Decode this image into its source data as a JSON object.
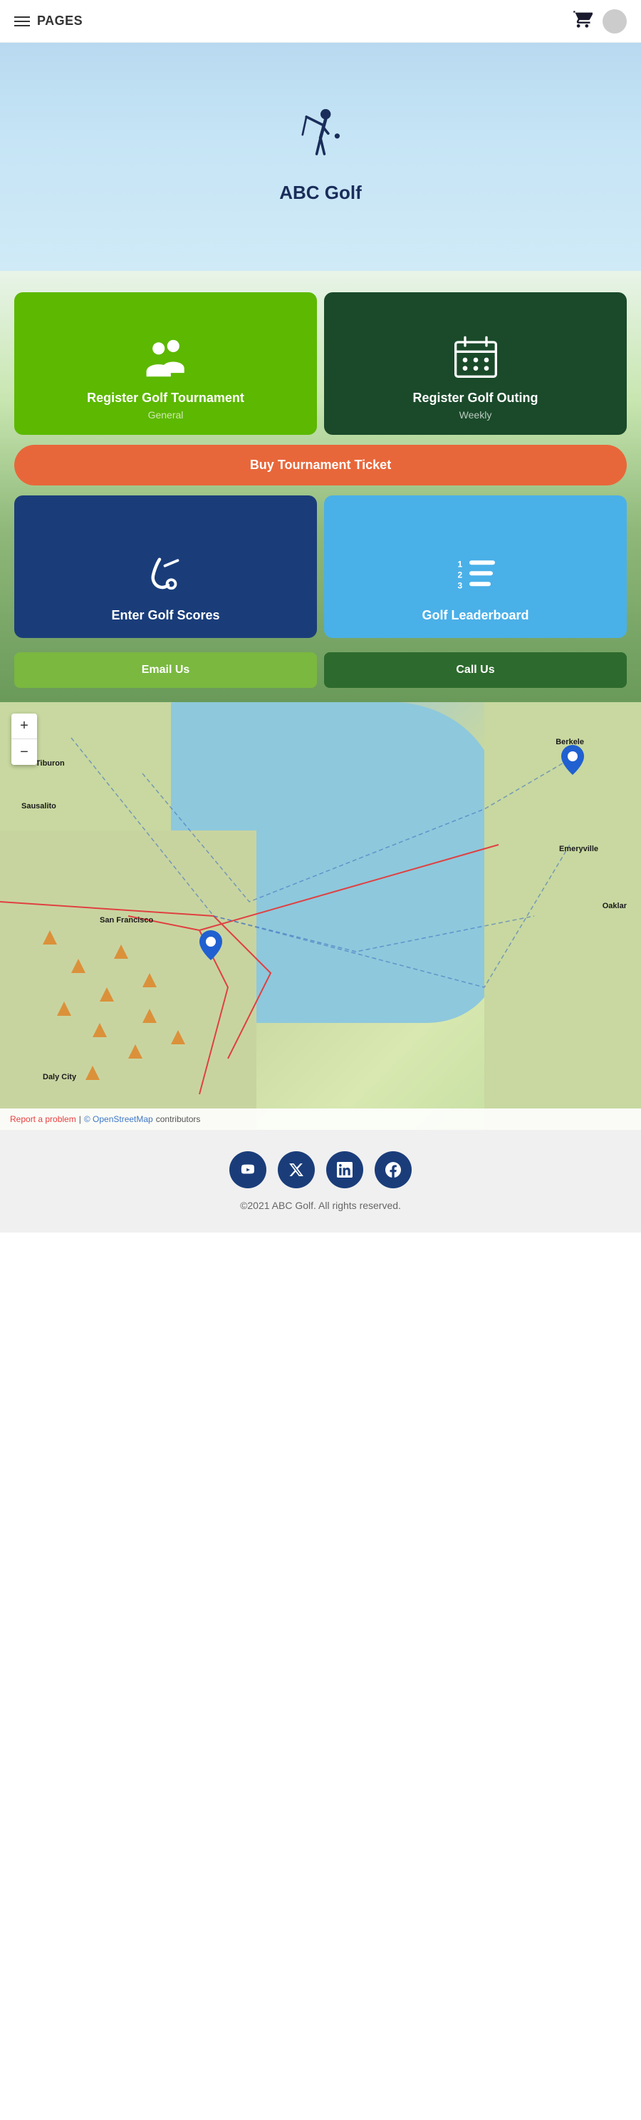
{
  "header": {
    "pages_label": "PAGES",
    "cart_icon": "cart-icon",
    "avatar_alt": "user avatar"
  },
  "hero": {
    "title": "ABC Golf",
    "icon": "golfer-icon"
  },
  "cards": {
    "register_tournament": {
      "title": "Register Golf Tournament",
      "subtitle": "General"
    },
    "register_outing": {
      "title": "Register Golf Outing",
      "subtitle": "Weekly"
    }
  },
  "buy_ticket": {
    "label": "Buy Tournament Ticket"
  },
  "action_cards": {
    "scores": {
      "title": "Enter Golf Scores"
    },
    "leaderboard": {
      "title": "Golf Leaderboard"
    }
  },
  "contact": {
    "email_label": "Email Us",
    "call_label": "Call Us"
  },
  "map": {
    "zoom_in": "+",
    "zoom_out": "−",
    "report_problem": "Report a problem",
    "osm_credit": "© OpenStreetMap",
    "contributors": " contributors",
    "city_label": "San Francisco",
    "daly_city_label": "Daly City",
    "tiburon_label": "Tiburon",
    "sausalito_label": "Sausalito",
    "berkeley_label": "Berkele",
    "emeryville_label": "Emeryville",
    "oakland_label": "Oaklar"
  },
  "social": {
    "youtube_label": "▶",
    "twitter_label": "𝕏",
    "linkedin_label": "in",
    "facebook_label": "f"
  },
  "footer": {
    "copyright": "©2021 ABC Golf. All rights reserved."
  }
}
